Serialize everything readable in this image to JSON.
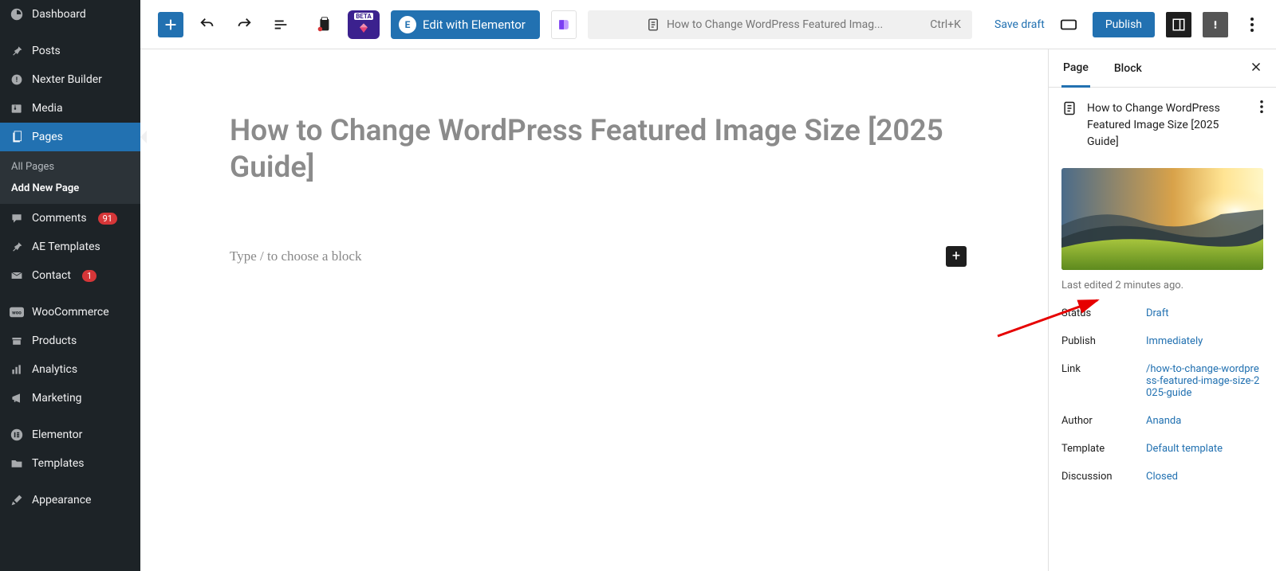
{
  "sidebar": {
    "dashboard": "Dashboard",
    "posts": "Posts",
    "nexter": "Nexter Builder",
    "media": "Media",
    "pages": "Pages",
    "sub_all": "All Pages",
    "sub_add": "Add New Page",
    "comments": "Comments",
    "comments_badge": "91",
    "ae": "AE Templates",
    "contact": "Contact",
    "contact_badge": "1",
    "woo": "WooCommerce",
    "products": "Products",
    "analytics": "Analytics",
    "marketing": "Marketing",
    "elementor": "Elementor",
    "templates": "Templates",
    "appearance": "Appearance"
  },
  "toolbar": {
    "edit_elementor": "Edit with Elementor",
    "cmd_title": "How to Change WordPress Featured Imag...",
    "cmd_short": "Ctrl+K",
    "save_draft": "Save draft",
    "publish": "Publish",
    "beta_label": "BETA"
  },
  "editor": {
    "title": "How to Change WordPress Featured Image Size [2025 Guide]",
    "placeholder": "Type / to choose a block"
  },
  "panel": {
    "tab_page": "Page",
    "tab_block": "Block",
    "title": "How to Change WordPress Featured Image Size [2025 Guide]",
    "last_edited": "Last edited 2 minutes ago.",
    "rows": {
      "status_k": "Status",
      "status_v": "Draft",
      "publish_k": "Publish",
      "publish_v": "Immediately",
      "link_k": "Link",
      "link_v": "/how-to-change-wordpress-featured-image-size-2025-guide",
      "author_k": "Author",
      "author_v": "Ananda",
      "template_k": "Template",
      "template_v": "Default template",
      "discussion_k": "Discussion",
      "discussion_v": "Closed"
    }
  }
}
